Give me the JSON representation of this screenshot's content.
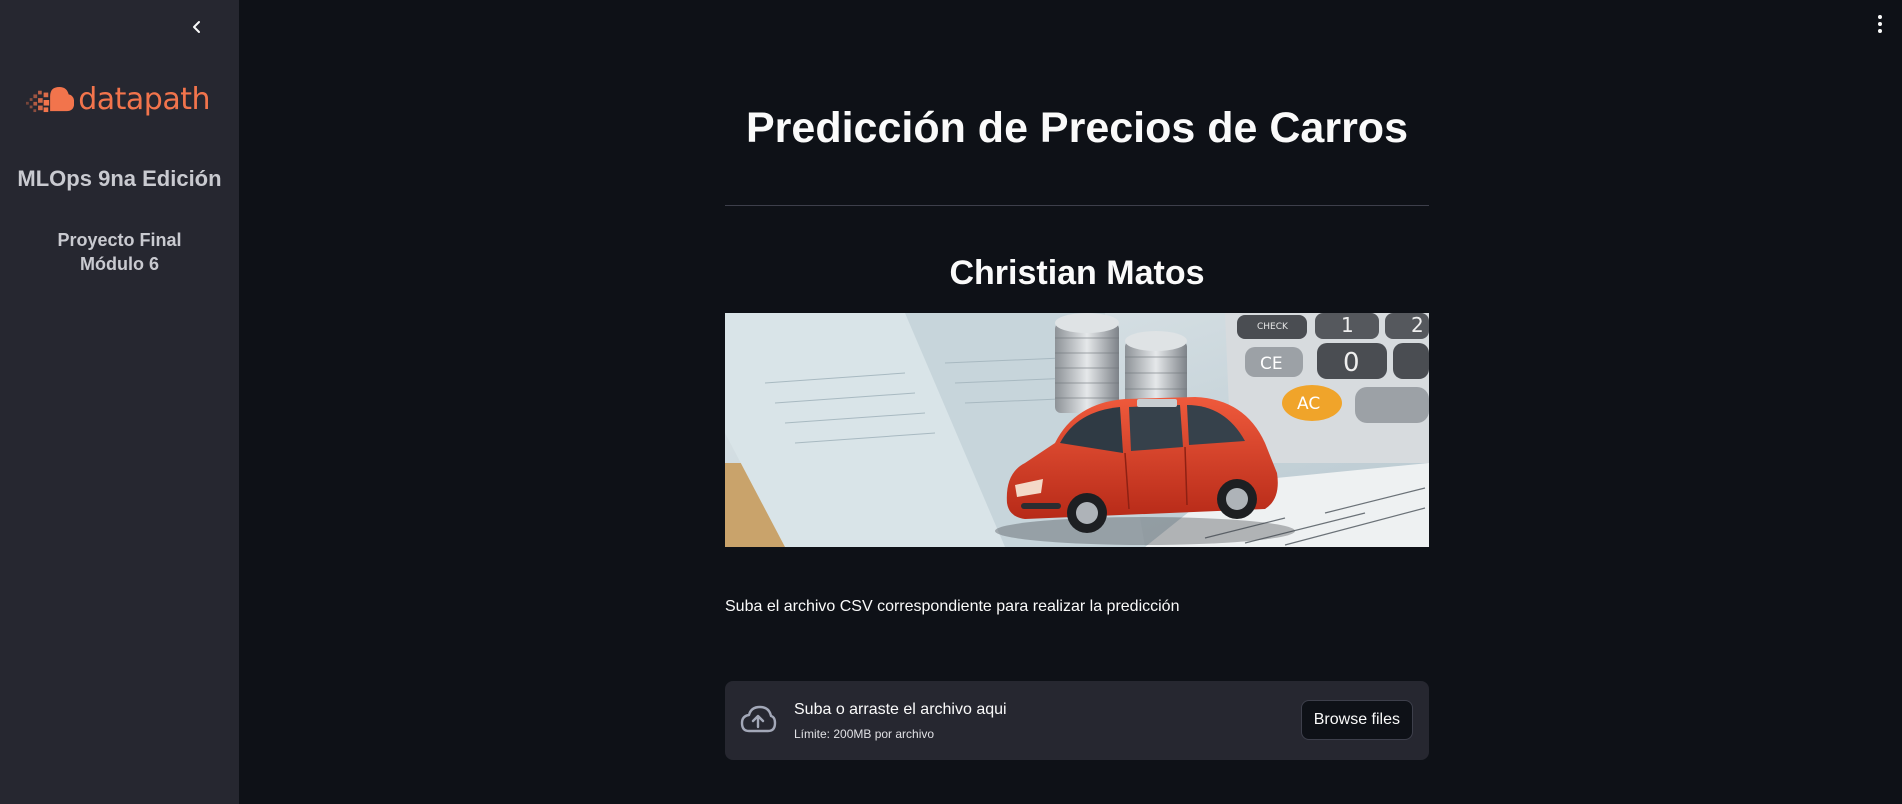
{
  "sidebar": {
    "logo_text": "datapath",
    "edition": "MLOps 9na Edición",
    "project_line1": "Proyecto Final",
    "project_line2": "Módulo 6"
  },
  "main": {
    "title": "Predicción de Precios de Carros",
    "author": "Christian Matos",
    "instruction": "Suba el archivo CSV correspondiente para realizar la predicción",
    "uploader": {
      "drop_text": "Suba o arraste el archivo aqui",
      "limit_text": "Límite: 200MB por archivo",
      "button_label": "Browse files"
    },
    "hero_keys": {
      "check": "CHECK",
      "ce": "CE",
      "zero": "0",
      "ac": "AC",
      "one": "1",
      "two": "2"
    }
  },
  "colors": {
    "background": "#0e1117",
    "sidebar": "#262730",
    "brand": "#f2744c",
    "car": "#d63a22"
  },
  "icons": {
    "collapse": "chevron-left-icon",
    "menu": "more-vertical-icon",
    "upload": "cloud-upload-icon"
  }
}
